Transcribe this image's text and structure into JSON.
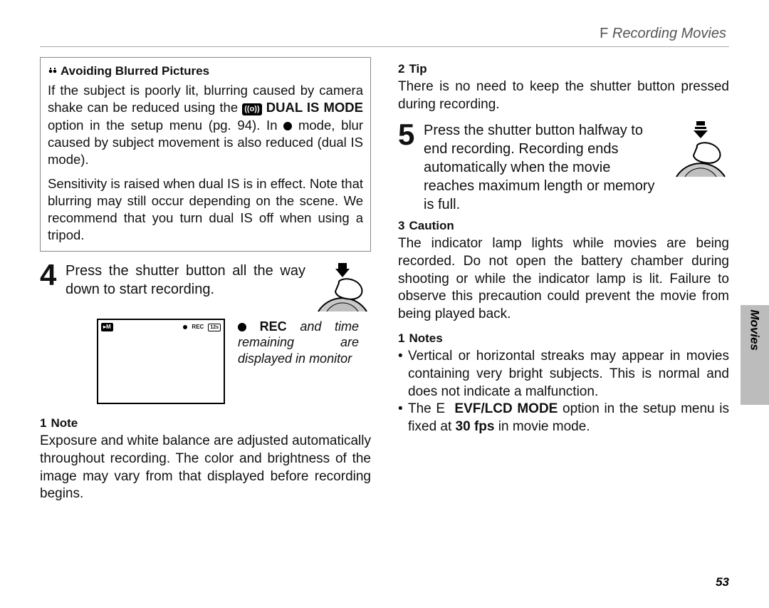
{
  "header": {
    "prefix": "F",
    "title": "Recording Movies"
  },
  "sidetab": {
    "label": "Movies"
  },
  "page_number": "53",
  "left": {
    "box": {
      "title": "Avoiding Blurred Pictures",
      "p1a": "If the subject is poorly lit, blurring caused by camera shake can be reduced using the ",
      "chip_icon": "((o))",
      "chip_label": "DUAL IS MODE",
      "p1b": " option in the setup menu (pg. 94). In ",
      "cam_glyph": "●",
      "p1c": " mode, blur caused by subject movement is also reduced (dual IS mode).",
      "p2": "Sensitivity is raised when dual IS is in effect. Note that blurring may still occur depending on the scene. We recommend that you turn dual IS off when using a tripod."
    },
    "step4": {
      "num": "4",
      "text": "Press the shutter button all the way down to start recording."
    },
    "recscreen": {
      "chip": "▸M",
      "rec": "REC",
      "time": "12s"
    },
    "reccaption": {
      "rec": "REC",
      "rest": " and time remaining are displayed in monitor"
    },
    "note": {
      "prefix": "1",
      "head": "Note",
      "text": "Exposure and white balance are adjusted automatically throughout recording. The color and brightness of the image may vary from that displayed before recording begins."
    }
  },
  "right": {
    "tip": {
      "prefix": "2",
      "head": "Tip",
      "text": "There is no need to keep the shutter button pressed during recording."
    },
    "step5": {
      "num": "5",
      "text": "Press the shutter button halfway to end recording. Recording ends automatically when the movie reaches maximum length or memory is full."
    },
    "caution": {
      "prefix": "3",
      "head": "Caution",
      "text": "The indicator lamp lights while movies are being recorded. Do not open the battery chamber during shooting or while the indicator lamp is lit. Failure to observe this precaution could prevent the movie from being played back."
    },
    "notes": {
      "prefix": "1",
      "head": "Notes",
      "items": [
        {
          "text": "Vertical or horizontal streaks may appear in movies containing very bright subjects. This is normal and does not indicate a malfunction."
        },
        {
          "pre": "The ",
          "eprefix": "E",
          "bold": "EVF/LCD MODE",
          "mid": " option in the setup menu is fixed at ",
          "fps": "30 fps",
          "post": " in movie mode."
        }
      ]
    }
  }
}
